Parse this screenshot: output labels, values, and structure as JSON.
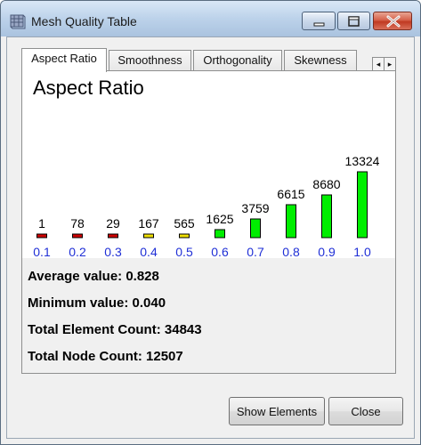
{
  "window": {
    "title": "Mesh Quality Table"
  },
  "tabs": [
    {
      "label": "Aspect Ratio",
      "active": true
    },
    {
      "label": "Smoothness",
      "active": false
    },
    {
      "label": "Orthogonality",
      "active": false
    },
    {
      "label": "Skewness",
      "active": false
    }
  ],
  "tab_scroll": {
    "left": "◂",
    "right": "▸"
  },
  "chart_data": {
    "type": "bar",
    "title": "Aspect Ratio",
    "categories": [
      "0.1",
      "0.2",
      "0.3",
      "0.4",
      "0.5",
      "0.6",
      "0.7",
      "0.8",
      "0.9",
      "1.0"
    ],
    "values": [
      1,
      78,
      29,
      167,
      565,
      1625,
      3759,
      6615,
      8680,
      13324
    ],
    "bar_colors": [
      "#cc0000",
      "#cc0000",
      "#cc0000",
      "#f0e000",
      "#f0e000",
      "#00ee00",
      "#00ee00",
      "#00ee00",
      "#00ee00",
      "#00ee00"
    ],
    "category_color": "#1f2fd6",
    "value_label_color": "#000000"
  },
  "stats": {
    "average": "Average value: 0.828",
    "minimum": "Minimum value: 0.040",
    "element_count": "Total Element Count: 34843",
    "node_count": "Total Node Count: 12507"
  },
  "buttons": {
    "show_elements": "Show Elements",
    "close": "Close"
  }
}
